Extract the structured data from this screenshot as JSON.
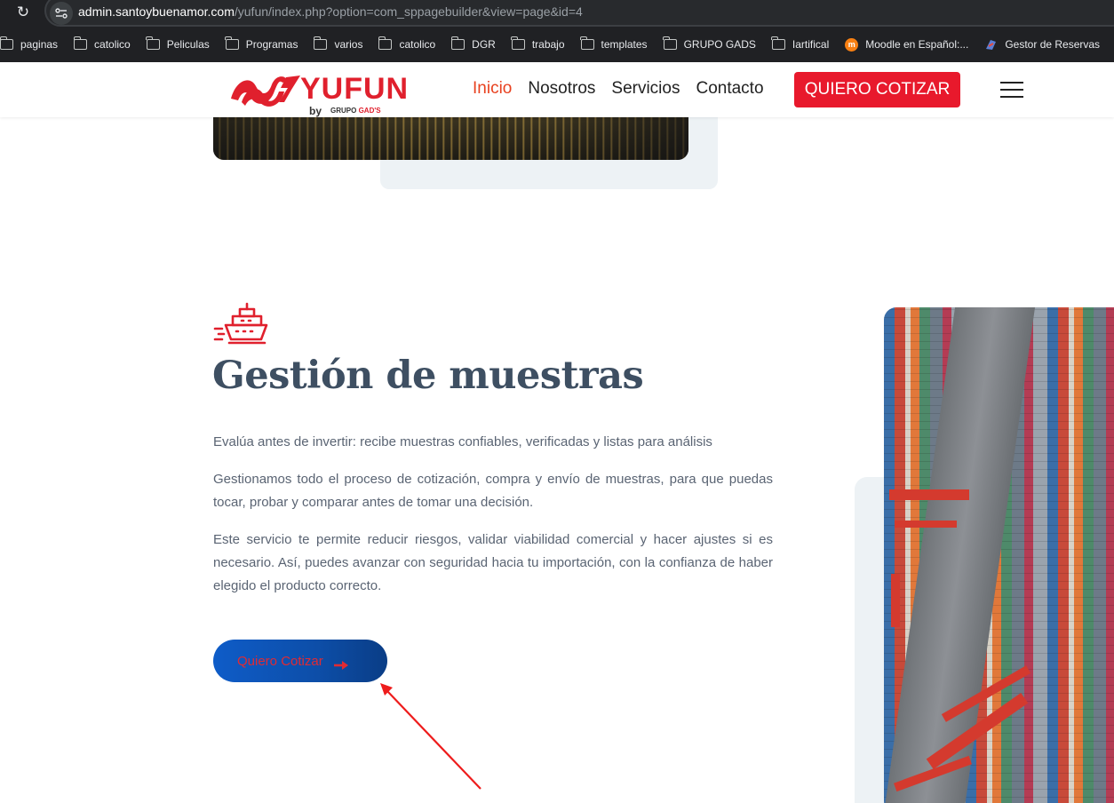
{
  "browser": {
    "url_host": "admin.santoybuenamor.com",
    "url_path": "/yufun/index.php?option=com_sppagebuilder&view=page&id=4",
    "bookmarks": [
      {
        "label": "paginas",
        "icon": "folder-icon"
      },
      {
        "label": "catolico",
        "icon": "folder-icon"
      },
      {
        "label": "Peliculas",
        "icon": "folder-icon"
      },
      {
        "label": "Programas",
        "icon": "folder-icon"
      },
      {
        "label": "varios",
        "icon": "folder-icon"
      },
      {
        "label": "catolico",
        "icon": "folder-icon"
      },
      {
        "label": "DGR",
        "icon": "folder-icon"
      },
      {
        "label": "trabajo",
        "icon": "folder-icon"
      },
      {
        "label": "templates",
        "icon": "folder-icon"
      },
      {
        "label": "GRUPO GADS",
        "icon": "folder-icon"
      },
      {
        "label": "Iartifical",
        "icon": "folder-icon"
      },
      {
        "label": "Moodle en Español:...",
        "icon": "moodle-icon"
      },
      {
        "label": "Gestor de Reservas",
        "icon": "gestor-icon"
      }
    ]
  },
  "header": {
    "logo_word": "YUFUN",
    "logo_by": "by",
    "logo_grupo": "GRUPO",
    "logo_gads": "GAD'S",
    "nav": [
      "Inicio",
      "Nosotros",
      "Servicios",
      "Contacto"
    ],
    "cta_label": "QUIERO COTIZAR"
  },
  "section": {
    "title": "Gestión de muestras",
    "paragraphs": [
      "Evalúa antes de invertir: recibe muestras confiables, verificadas y listas para análisis",
      "Gestionamos todo el proceso de cotización, compra y envío de muestras, para que puedas tocar, probar y comparar antes de tomar una decisión.",
      "Este servicio te permite reducir riesgos, validar viabilidad comercial y hacer ajustes si es necesario. Así, puedes avanzar con seguridad hacia tu importación, con la confianza de haber elegido el producto correcto."
    ],
    "button_label": "Quiero Cotizar"
  },
  "colors": {
    "brand_red": "#e8192c",
    "nav_active": "#e8411f",
    "title_color": "#3e4f62",
    "button_blue": "#0e5cc8",
    "button_text": "#e22a32"
  }
}
